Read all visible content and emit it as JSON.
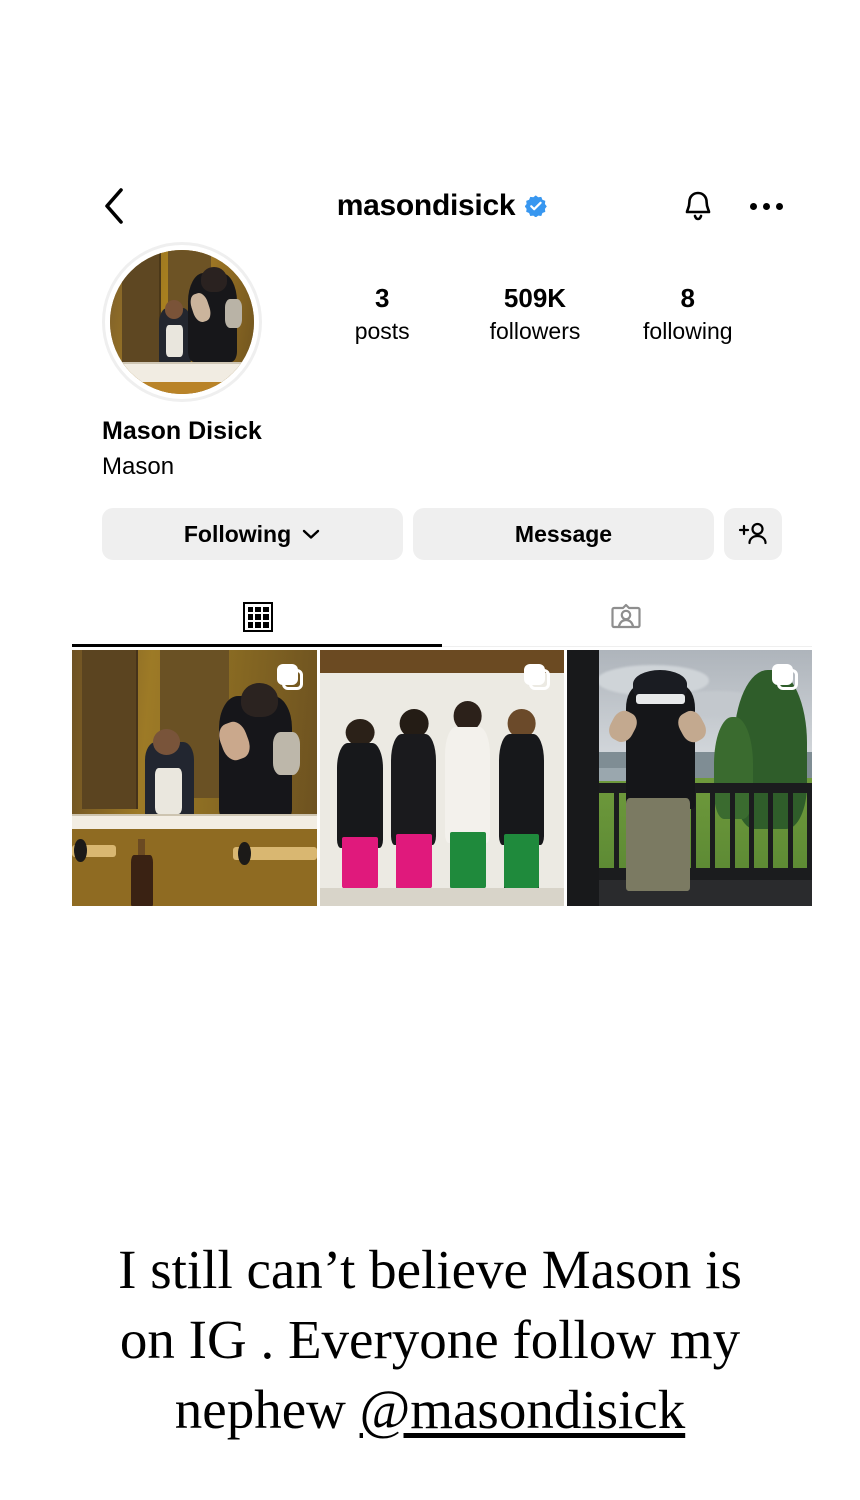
{
  "header": {
    "back_icon": "back-chevron-icon",
    "username": "masondisick",
    "verified_badge": "verified-badge-icon",
    "notifications_icon": "bell-icon",
    "more_icon": "more-options-icon",
    "verified_color": "#3897f0"
  },
  "profile": {
    "avatar_alt": "mirror-selfie-avatar",
    "full_name": "Mason Disick",
    "bio": "Mason",
    "stats": [
      {
        "value": "3",
        "label": "posts"
      },
      {
        "value": "509K",
        "label": "followers"
      },
      {
        "value": "8",
        "label": "following"
      }
    ]
  },
  "actions": {
    "following_label": "Following",
    "following_chevron": "chevron-down-icon",
    "message_label": "Message",
    "add_person_icon": "add-person-icon",
    "button_bg": "#efefef"
  },
  "tabs": [
    {
      "name": "grid",
      "icon": "grid-icon",
      "active": true
    },
    {
      "name": "tagged",
      "icon": "tagged-person-icon",
      "active": false
    }
  ],
  "posts": [
    {
      "alt": "mirror-selfie-post",
      "carousel": true
    },
    {
      "alt": "four-friends-with-shopping-bags-post",
      "carousel": true
    },
    {
      "alt": "deck-outdoors-post",
      "carousel": true
    }
  ],
  "caption": {
    "line1": "I still can’t believe Mason is",
    "line2": "on IG . Everyone follow my",
    "line3_prefix": "nephew ",
    "line3_mention": "@masondisick"
  }
}
